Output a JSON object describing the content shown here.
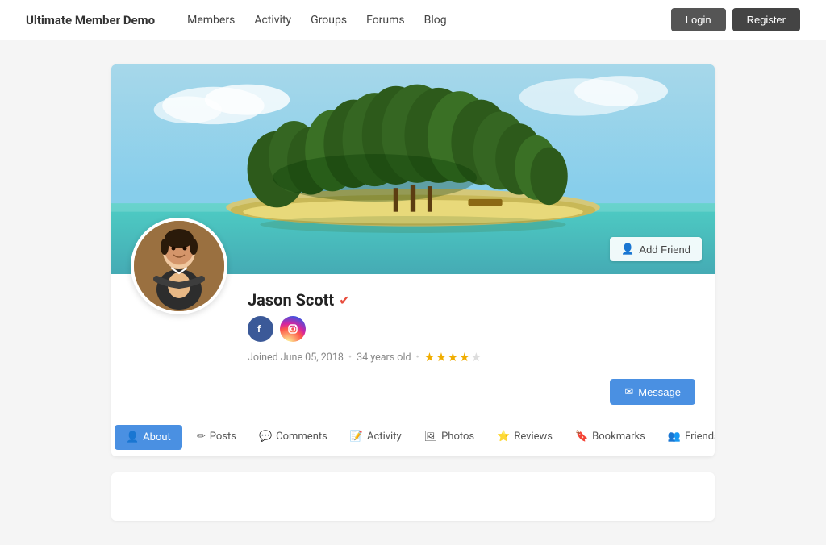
{
  "navbar": {
    "brand": "Ultimate Member Demo",
    "nav_items": [
      {
        "label": "Members",
        "href": "#"
      },
      {
        "label": "Activity",
        "href": "#"
      },
      {
        "label": "Groups",
        "href": "#"
      },
      {
        "label": "Forums",
        "href": "#"
      },
      {
        "label": "Blog",
        "href": "#"
      }
    ],
    "login_label": "Login",
    "register_label": "Register"
  },
  "profile": {
    "name": "Jason Scott",
    "verified": true,
    "joined": "Joined June 05, 2018",
    "age": "34 years old",
    "rating": 3.5,
    "stars": [
      true,
      true,
      true,
      true,
      false
    ],
    "add_friend_label": "Add Friend",
    "message_label": "Message",
    "social": [
      {
        "name": "Facebook",
        "icon": "f",
        "type": "fb"
      },
      {
        "name": "Instagram",
        "icon": "ig",
        "type": "ig"
      }
    ]
  },
  "tabs": [
    {
      "label": "About",
      "icon": "👤",
      "active": true
    },
    {
      "label": "Posts",
      "icon": "✏️",
      "active": false
    },
    {
      "label": "Comments",
      "icon": "💬",
      "active": false
    },
    {
      "label": "Activity",
      "icon": "📝",
      "active": false
    },
    {
      "label": "Photos",
      "icon": "🖼️",
      "active": false
    },
    {
      "label": "Reviews",
      "icon": "⭐",
      "active": false
    },
    {
      "label": "Bookmarks",
      "icon": "🔖",
      "active": false
    },
    {
      "label": "Friends",
      "icon": "👥",
      "active": false
    }
  ]
}
